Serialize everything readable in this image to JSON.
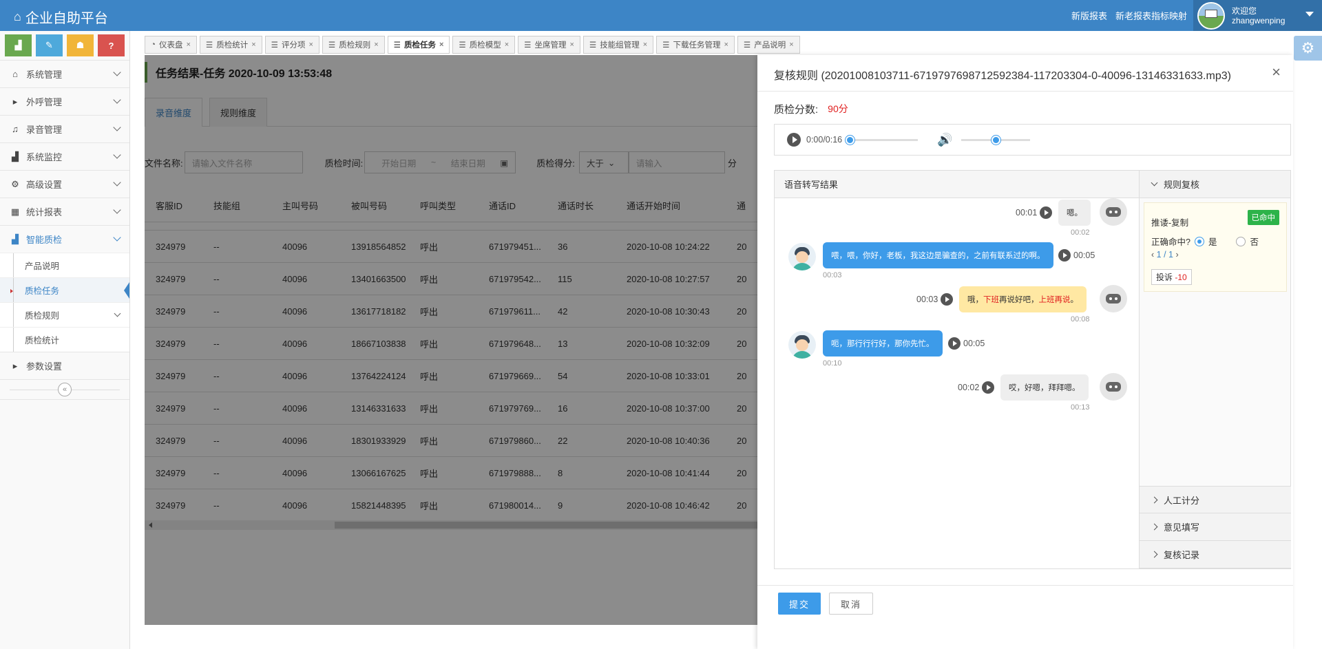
{
  "app": {
    "title": "企业自助平台",
    "link_new_report": "新版报表",
    "link_old_report": "新老报表指标映射",
    "welcome": "欢迎您",
    "username": "zhangwenping"
  },
  "colors": {
    "primary": "#3d85c6",
    "accent_blue": "#3d9be9",
    "score_red": "#e02020",
    "hit_green": "#2db34a"
  },
  "shortcuts": [
    {
      "icon": "bar-chart-icon",
      "color": "#6aa84f",
      "glyph": "▟"
    },
    {
      "icon": "pencil-icon",
      "color": "#4ea9db",
      "glyph": "✎"
    },
    {
      "icon": "group-icon",
      "color": "#f1b539",
      "glyph": "☗"
    },
    {
      "icon": "help-icon",
      "color": "#d9534f",
      "glyph": "?"
    }
  ],
  "nav": {
    "system": "系统管理",
    "outbound": "外呼管理",
    "recording": "录音管理",
    "monitor": "系统监控",
    "advanced": "高级设置",
    "reports": "统计报表",
    "qc": "智能质检",
    "sub_product": "产品说明",
    "sub_task": "质检任务",
    "sub_rule": "质检规则",
    "sub_stats": "质检统计",
    "params": "参数设置"
  },
  "tabs": [
    "仪表盘",
    "质检统计",
    "评分项",
    "质检规则",
    "质检任务",
    "质检模型",
    "坐席管理",
    "技能组管理",
    "下载任务管理",
    "产品说明"
  ],
  "main": {
    "title": "任务结果-任务 2020-10-09 13:53:48",
    "tab_recording": "录音维度",
    "tab_rule": "规则维度",
    "f_filename": "文件名称:",
    "f_filename_ph": "请输入文件名称",
    "f_qctime": "质检时间:",
    "f_start": "开始日期",
    "f_tilde": "~",
    "f_end": "结束日期",
    "f_score": "质检得分:",
    "f_cmp": "大于",
    "f_score_ph": "请输入",
    "f_unit": "分"
  },
  "table": {
    "headers": [
      "客服ID",
      "技能组",
      "主叫号码",
      "被叫号码",
      "呼叫类型",
      "通话ID",
      "通话时长",
      "通话开始时间",
      "通"
    ],
    "rows": [
      [
        "324979",
        "--",
        "40096",
        "13918564852",
        "呼出",
        "671979451...",
        "36",
        "2020-10-08 10:24:22",
        "20"
      ],
      [
        "324979",
        "--",
        "40096",
        "13401663500",
        "呼出",
        "671979542...",
        "115",
        "2020-10-08 10:27:57",
        "20"
      ],
      [
        "324979",
        "--",
        "40096",
        "13617718182",
        "呼出",
        "671979611...",
        "42",
        "2020-10-08 10:30:43",
        "20"
      ],
      [
        "324979",
        "--",
        "40096",
        "18667103838",
        "呼出",
        "671979648...",
        "13",
        "2020-10-08 10:32:09",
        "20"
      ],
      [
        "324979",
        "--",
        "40096",
        "13764224124",
        "呼出",
        "671979669...",
        "54",
        "2020-10-08 10:33:01",
        "20"
      ],
      [
        "324979",
        "--",
        "40096",
        "13146331633",
        "呼出",
        "671979769...",
        "16",
        "2020-10-08 10:37:00",
        "20"
      ],
      [
        "324979",
        "--",
        "40096",
        "18301933929",
        "呼出",
        "671979860...",
        "22",
        "2020-10-08 10:40:36",
        "20"
      ],
      [
        "324979",
        "--",
        "40096",
        "13066167625",
        "呼出",
        "671979888...",
        "8",
        "2020-10-08 10:41:44",
        "20"
      ],
      [
        "324979",
        "--",
        "40096",
        "15821448395",
        "呼出",
        "671980014...",
        "9",
        "2020-10-08 10:46:42",
        "20"
      ]
    ]
  },
  "panel": {
    "title": "复核规则 (20201008103711-6719797698712592384-117203304-0-40096-13146331633.mp3)",
    "score_label": "质检分数:",
    "score_value": "90分",
    "audio_time": "0:00/0:16",
    "audio_progress": 0.0,
    "volume_level": 0.5,
    "transcript_title": "语音转写结果",
    "messages": [
      {
        "side": "right",
        "style": "gray",
        "text": "嗯。",
        "start": "00:01",
        "end": "00:02"
      },
      {
        "side": "left",
        "style": "blue",
        "text": "喂，喂，你好，老板，我这边是骗查的，之前有联系过的啊。",
        "start": "00:03",
        "end": "00:05"
      },
      {
        "side": "right",
        "style": "yellow",
        "pre": "哦，",
        "hl1": "下班",
        "mid": "再说好吧，",
        "hl2": "上班再说",
        "post": "。",
        "start": "00:03",
        "end": "00:08"
      },
      {
        "side": "left",
        "style": "blue",
        "text": "呃，那行行行好，那你先忙。",
        "start": "00:10",
        "end": "00:05"
      },
      {
        "side": "right",
        "style": "gray",
        "text": "哎，好嗯，拜拜嗯。",
        "start": "00:02",
        "end": "00:13"
      }
    ],
    "rule_review": "规则复核",
    "rule_name": "推诿-复制",
    "hit_badge": "已命中",
    "hit_question": "正确命中?",
    "opt_yes": "是",
    "opt_no": "否",
    "pager": "1 / 1",
    "complaint": "投诉",
    "deduction": "-10",
    "manual_score": "人工计分",
    "opinion": "意见填写",
    "review_log": "复核记录",
    "submit": "提交",
    "cancel": "取消"
  }
}
